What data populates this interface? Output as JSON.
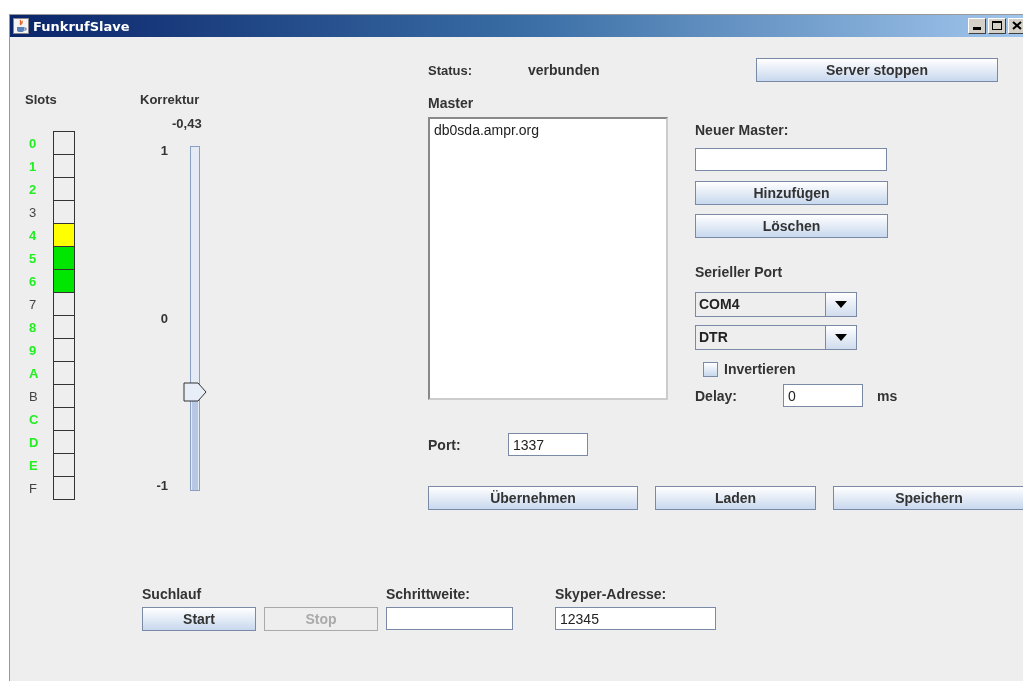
{
  "window": {
    "title": "FunkrufSlave"
  },
  "slots": {
    "label": "Slots",
    "items": [
      {
        "label": "0",
        "enabled": true
      },
      {
        "label": "1",
        "enabled": true
      },
      {
        "label": "2",
        "enabled": true
      },
      {
        "label": "3",
        "enabled": false
      },
      {
        "label": "4",
        "enabled": true,
        "color": "#ffff00"
      },
      {
        "label": "5",
        "enabled": true,
        "color": "#00e600"
      },
      {
        "label": "6",
        "enabled": true,
        "color": "#00e600"
      },
      {
        "label": "7",
        "enabled": false
      },
      {
        "label": "8",
        "enabled": true
      },
      {
        "label": "9",
        "enabled": true
      },
      {
        "label": "A",
        "enabled": true
      },
      {
        "label": "B",
        "enabled": false
      },
      {
        "label": "C",
        "enabled": true
      },
      {
        "label": "D",
        "enabled": true
      },
      {
        "label": "E",
        "enabled": true
      },
      {
        "label": "F",
        "enabled": false
      }
    ]
  },
  "correction": {
    "label": "Korrektur",
    "reading": "-0,43",
    "level": 0.285,
    "ticks": [
      "1",
      "0",
      "-1"
    ]
  },
  "status": {
    "label": "Status:",
    "value": "verbunden"
  },
  "server_button": "Server stoppen",
  "master": {
    "label": "Master",
    "items": [
      "db0sda.ampr.org"
    ]
  },
  "new_master": {
    "label": "Neuer Master:",
    "buttons": [
      "Hinzufügen",
      "Löschen"
    ]
  },
  "serial": {
    "label": "Serieller Port",
    "port": "COM4",
    "line": "DTR",
    "invert": {
      "label": "Invertieren",
      "checked": false
    },
    "delay_label": "Delay:",
    "delay": "0",
    "delay_unit": "ms"
  },
  "port": {
    "label": "Port:",
    "value": "1337"
  },
  "actions": [
    "Übernehmen",
    "Laden",
    "Speichern"
  ],
  "scan": {
    "label": "Suchlauf",
    "start": {
      "label": "Start",
      "disabled": false
    },
    "stop": {
      "label": "Stop",
      "disabled": true
    }
  },
  "step": {
    "label": "Schrittweite:"
  },
  "skyper": {
    "label": "Skyper-Adresse:",
    "value": "12345"
  }
}
